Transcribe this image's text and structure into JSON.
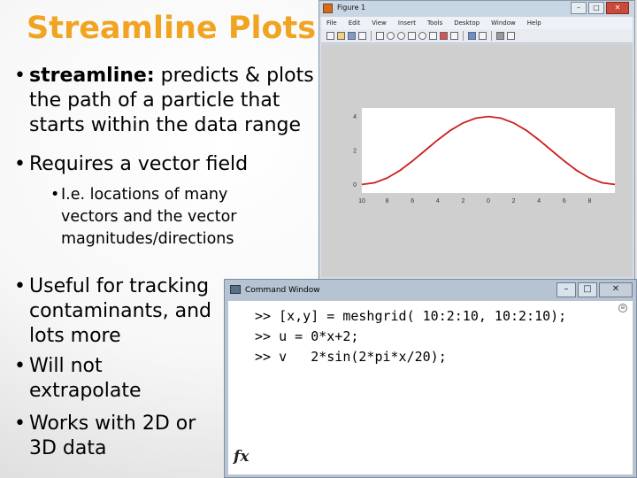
{
  "slide": {
    "title": "Streamline Plots",
    "bullets": [
      {
        "keyword": "streamline:",
        "line1_rest": " predicts & plots",
        "line2": "the path of a particle that",
        "line3": "starts within the data range"
      },
      {
        "text": "Requires a vector field"
      },
      {
        "line1": "I.e. locations of many",
        "line2": "vectors and the vector",
        "line3": "magnitudes/directions"
      },
      {
        "line1": "Useful for tracking",
        "line2": "contaminants, and",
        "line3": "lots more"
      },
      {
        "line1": "Will not",
        "line2": "extrapolate"
      },
      {
        "line1": "Works with 2D or",
        "line2": "3D data"
      }
    ]
  },
  "figure_window": {
    "title": "Figure 1",
    "menu": [
      "File",
      "Edit",
      "View",
      "Insert",
      "Tools",
      "Desktop",
      "Window",
      "Help"
    ],
    "toolbar_icons": [
      "new-file-icon",
      "open-folder-icon",
      "save-icon",
      "print-icon",
      "pointer-icon",
      "zoom-in-icon",
      "zoom-out-icon",
      "pan-icon",
      "rotate-icon",
      "data-cursor-icon",
      "brush-icon",
      "link-icon",
      "colorbar-icon",
      "legend-icon",
      "hide-plot-tools-icon",
      "show-plot-tools-icon"
    ],
    "window_buttons": {
      "minimize": "–",
      "maximize": "□",
      "close": "✕"
    }
  },
  "chart_data": {
    "type": "line",
    "title": "",
    "xlabel": "",
    "ylabel": "",
    "x_tick_labels": [
      "10",
      "8",
      "6",
      "4",
      "2",
      "0",
      "2",
      "4",
      "6",
      "8"
    ],
    "y_tick_labels": [
      "4",
      "2",
      "0"
    ],
    "x": [
      -10,
      -9,
      -8,
      -7,
      -6,
      -5,
      -4,
      -3,
      -2,
      -1,
      0,
      1,
      2,
      3,
      4,
      5,
      6,
      7,
      8,
      9,
      10
    ],
    "series": [
      {
        "values": [
          0,
          0.1,
          0.38,
          0.82,
          1.38,
          2.0,
          2.62,
          3.18,
          3.62,
          3.9,
          4.0,
          3.9,
          3.62,
          3.18,
          2.62,
          2.0,
          1.38,
          0.82,
          0.38,
          0.1,
          0
        ],
        "color": "#cc1f1f"
      }
    ],
    "xlim": [
      -10,
      10
    ],
    "ylim": [
      -0.5,
      4.5
    ],
    "grid": false
  },
  "command_window": {
    "title": "Command Window",
    "lines": [
      ">> [x,y] = meshgrid( 10:2:10, 10:2:10);",
      ">> u = 0*x+2;",
      ">> v   2*sin(2*pi*x/20);"
    ],
    "fx_label": "fx",
    "window_buttons": {
      "minimize": "–",
      "maximize": "□",
      "close": "✕"
    }
  },
  "colors": {
    "title_accent": "#f0a422",
    "plot_line": "#cc1f1f"
  }
}
